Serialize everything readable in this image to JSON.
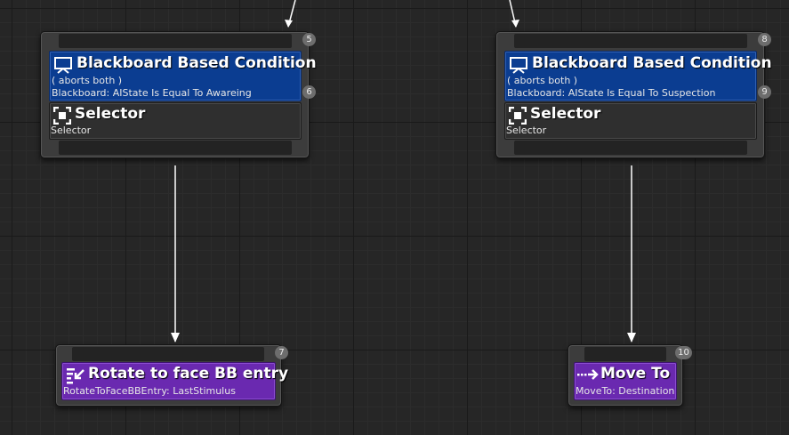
{
  "nodes": {
    "left_selector": {
      "badge_top": "5",
      "decorator": {
        "badge": "6",
        "title": "Blackboard Based Condition",
        "aborts": "( aborts both )",
        "detail": "Blackboard: AIState Is Equal To Awareing"
      },
      "composite": {
        "title": "Selector",
        "detail": "Selector"
      }
    },
    "right_selector": {
      "badge_top": "8",
      "decorator": {
        "badge": "9",
        "title": "Blackboard Based Condition",
        "aborts": "( aborts both )",
        "detail": "Blackboard: AIState Is Equal To Suspection"
      },
      "composite": {
        "title": "Selector",
        "detail": "Selector"
      }
    },
    "rotate_task": {
      "badge": "7",
      "title": "Rotate to face BB entry",
      "detail": "RotateToFaceBBEntry: LastStimulus"
    },
    "move_task": {
      "badge": "10",
      "title": "Move To",
      "detail": "MoveTo: Destination"
    }
  },
  "icons": {
    "decorator": "monitor-icon",
    "composite": "selector-icon",
    "rotate_task": "rotate-list-icon",
    "move_task": "dotted-arrow-icon"
  },
  "colors": {
    "background": "#262626",
    "node": "#3c3c3c",
    "decorator": "#0b3d91",
    "task": "#6a29b0",
    "wire": "#ffffff",
    "badge": "#6d6d6d"
  }
}
